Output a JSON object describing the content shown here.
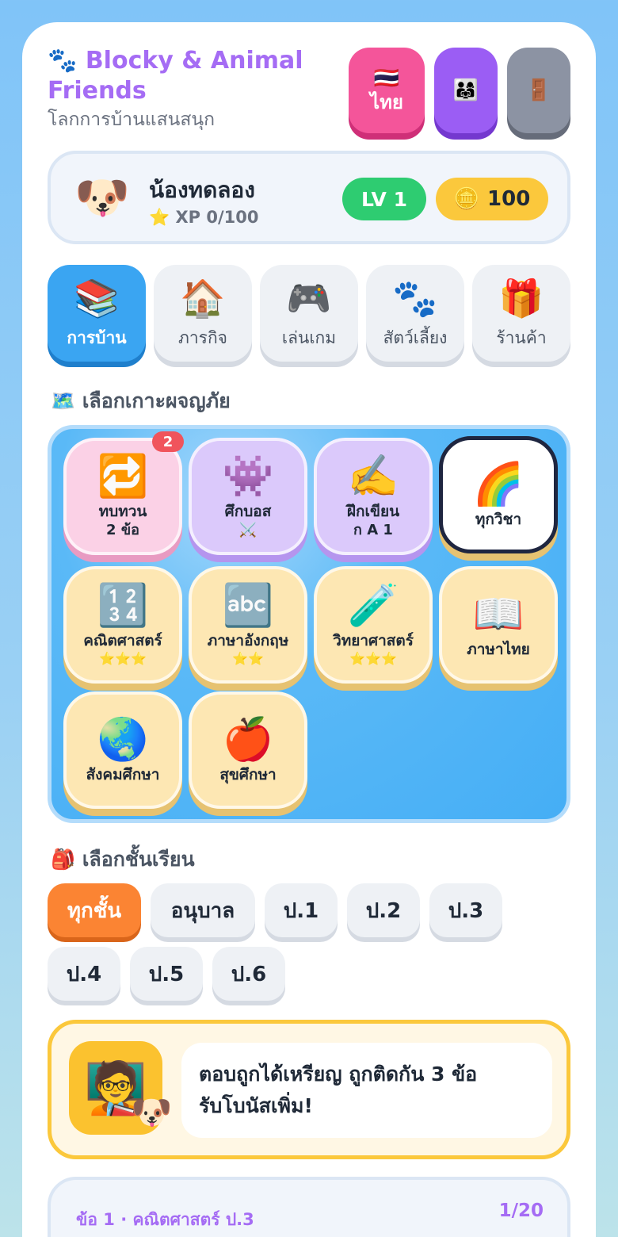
{
  "app": {
    "title_icon": "🐾",
    "title": "Blocky & Animal Friends",
    "subtitle": "โลกการบ้านแสนสนุก"
  },
  "header_buttons": {
    "lang_flag": "🇹🇭",
    "lang_label": "ไทย",
    "parent_icon": "👨‍👩‍👧",
    "exit_icon": "🚪"
  },
  "profile": {
    "avatar": "🐶",
    "name": "น้องทดลอง",
    "xp": "⭐ XP 0/100",
    "level": "LV 1",
    "coin_icon": "🪙",
    "coins": "100"
  },
  "tabs": [
    {
      "icon": "📚",
      "label": "การบ้าน",
      "active": true
    },
    {
      "icon": "🏠",
      "label": "ภารกิจ"
    },
    {
      "icon": "🎮",
      "label": "เล่นเกม"
    },
    {
      "icon": "🐾",
      "label": "สัตว์เลี้ยง"
    },
    {
      "icon": "🎁",
      "label": "ร้านค้า"
    }
  ],
  "islands_section": {
    "icon": "🗺️",
    "title": "เลือกเกาะผจญภัย",
    "review_badge": "2",
    "tiles": [
      {
        "icon": "🔁",
        "name": "ทบทวน",
        "sub": "2 ข้อ",
        "color": "pink"
      },
      {
        "icon": "👾",
        "name": "ศึกบอส",
        "sub": "⚔️",
        "color": "purple"
      },
      {
        "icon": "✍️",
        "name": "ฝึกเขียน",
        "sub": "ก A 1",
        "color": "purple"
      },
      {
        "icon": "🌈",
        "name": "ทุกวิชา",
        "color": "white",
        "selected": true
      },
      {
        "icon": "🔢",
        "name": "คณิตศาสตร์",
        "stars": "⭐⭐⭐",
        "color": "yellow"
      },
      {
        "icon": "🔤",
        "name": "ภาษาอังกฤษ",
        "stars": "⭐⭐",
        "color": "yellow"
      },
      {
        "icon": "🧪",
        "name": "วิทยาศาสตร์",
        "stars": "⭐⭐⭐",
        "color": "yellow"
      },
      {
        "icon": "📖",
        "name": "ภาษาไทย",
        "color": "yellow"
      },
      {
        "icon": "🌏",
        "name": "สังคมศึกษา",
        "color": "yellow"
      },
      {
        "icon": "🍎",
        "name": "สุขศึกษา",
        "color": "yellow"
      }
    ]
  },
  "grade_section": {
    "icon": "🎒",
    "title": "เลือกชั้นเรียน",
    "grades": [
      "ทุกชั้น",
      "อนุบาล",
      "ป.1",
      "ป.2",
      "ป.3",
      "ป.4",
      "ป.5",
      "ป.6"
    ],
    "active": "ทุกชั้น"
  },
  "tip": {
    "icon": "🧑‍🏫",
    "pet": "🐶",
    "text_line1": "ตอบถูกได้เหรียญ ถูกติดกัน 3 ข้อ",
    "text_line2": "รับโบนัสเพิ่ม!"
  },
  "question": {
    "label": "ข้อ 1 · คณิตศาสตร์ ป.3",
    "counter": "1/20"
  },
  "colors": {
    "brand": "#a56cf4",
    "lang_button": "#f4559a",
    "parent_button": "#9b5df4",
    "exit_button": "#8c93a3",
    "level": "#2ecc71",
    "coins": "#fbc83c",
    "active_tab": "#3aa5f2",
    "active_grade": "#fb8433"
  }
}
